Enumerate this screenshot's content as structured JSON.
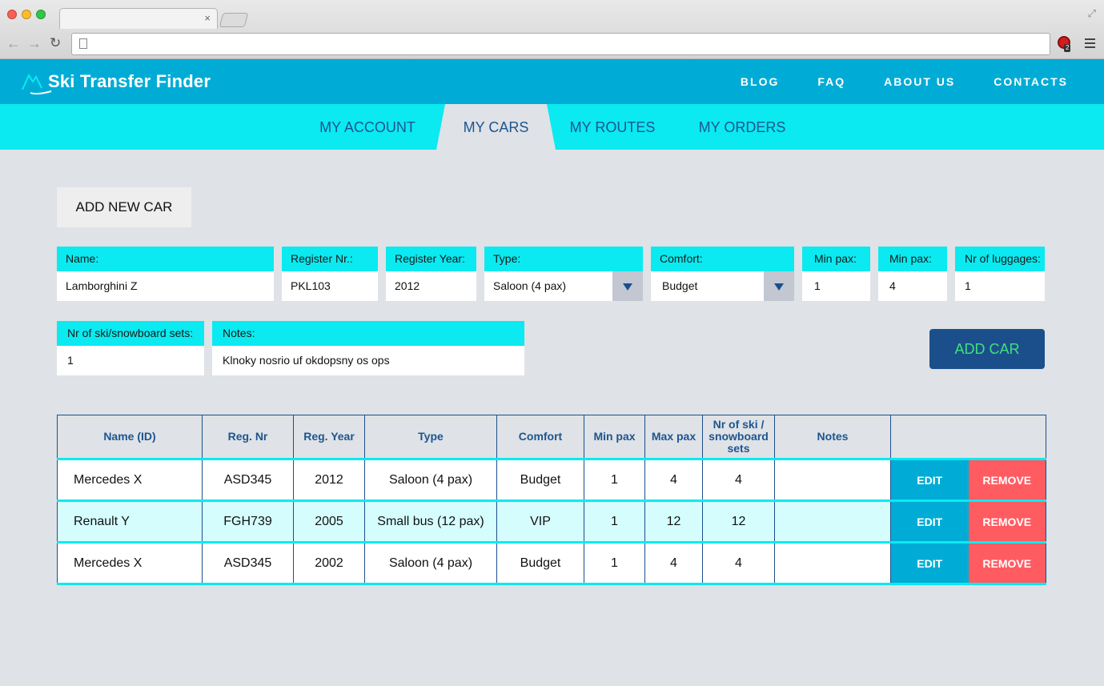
{
  "browser": {
    "tab_close": "×",
    "extension_badge": "2"
  },
  "site": {
    "logo_text": "Ski Transfer Finder",
    "topnav": [
      "BLOG",
      "FAQ",
      "ABOUT US",
      "CONTACTS"
    ],
    "subnav": [
      "MY ACCOUNT",
      "MY CARS",
      "MY ROUTES",
      "MY ORDERS"
    ],
    "subnav_active": "MY CARS"
  },
  "form": {
    "add_new_label": "ADD NEW CAR",
    "name": {
      "label": "Name:",
      "value": "Lamborghini Z"
    },
    "register_nr": {
      "label": "Register Nr.:",
      "value": "PKL103"
    },
    "register_year": {
      "label": "Register Year:",
      "value": "2012"
    },
    "type": {
      "label": "Type:",
      "value": "Saloon (4 pax)"
    },
    "comfort": {
      "label": "Comfort:",
      "value": "Budget"
    },
    "min_pax": {
      "label": "Min pax:",
      "value": "1"
    },
    "max_pax": {
      "label": "Min pax:",
      "value": "4"
    },
    "luggages": {
      "label": "Nr of luggages:",
      "value": "1"
    },
    "ski_sets": {
      "label": "Nr of ski/snowboard sets:",
      "value": "1"
    },
    "notes": {
      "label": "Notes:",
      "value": "Klnoky nosrio uf okdopsny os ops"
    },
    "submit_label": "ADD CAR"
  },
  "table": {
    "headers": [
      "Name (ID)",
      "Reg. Nr",
      "Reg. Year",
      "Type",
      "Comfort",
      "Min pax",
      "Max pax",
      "Nr of ski / snowboard sets",
      "Notes",
      ""
    ],
    "rows": [
      {
        "name": "Mercedes X",
        "reg_nr": "ASD345",
        "reg_year": "2012",
        "type": "Saloon (4 pax)",
        "comfort": "Budget",
        "min_pax": "1",
        "max_pax": "4",
        "ski_sets": "4",
        "notes": ""
      },
      {
        "name": "Renault Y",
        "reg_nr": "FGH739",
        "reg_year": "2005",
        "type": "Small bus (12 pax)",
        "comfort": "VIP",
        "min_pax": "1",
        "max_pax": "12",
        "ski_sets": "12",
        "notes": ""
      },
      {
        "name": "Mercedes X",
        "reg_nr": "ASD345",
        "reg_year": "2002",
        "type": "Saloon (4 pax)",
        "comfort": "Budget",
        "min_pax": "1",
        "max_pax": "4",
        "ski_sets": "4",
        "notes": ""
      }
    ],
    "edit_label": "EDIT",
    "remove_label": "REMOVE"
  },
  "colors": {
    "header": "#00acd6",
    "subnav": "#0aeaf0",
    "primary_button": "#1b4f8c",
    "primary_button_text": "#3ee07a",
    "edit": "#00acd6",
    "remove": "#ff5c62"
  },
  "icons": [
    "back-arrow-icon",
    "forward-arrow-icon",
    "reload-icon",
    "page-icon",
    "extension-icon",
    "menu-icon",
    "mountain-logo-icon",
    "dropdown-arrow-icon"
  ]
}
